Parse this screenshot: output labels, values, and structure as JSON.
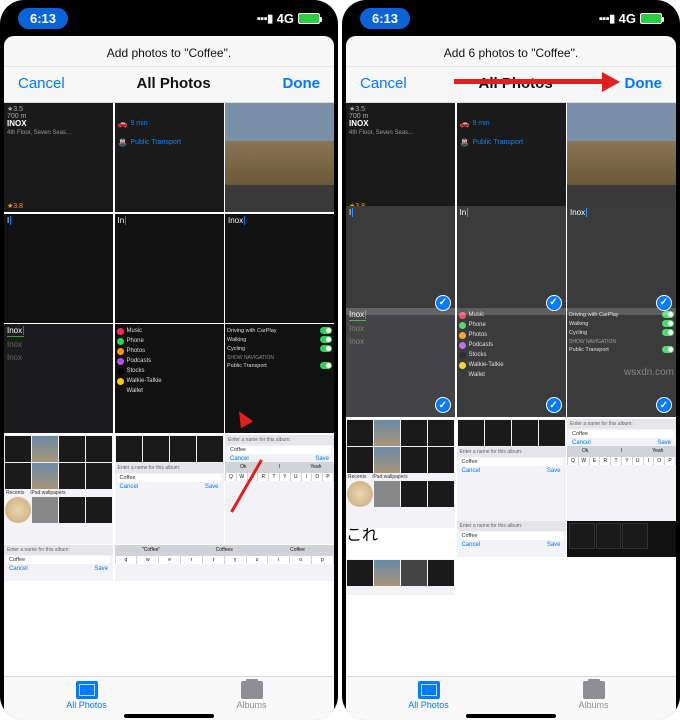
{
  "status": {
    "time": "6:13",
    "network": "4G"
  },
  "left": {
    "title": "Add photos to \"Coffee\".",
    "cancel": "Cancel",
    "picker_title": "All Photos",
    "done": "Done"
  },
  "right": {
    "title": "Add 6 photos to \"Coffee\".",
    "cancel": "Cancel",
    "picker_title": "All Photos",
    "done": "Done"
  },
  "maps": {
    "rating": "★3.5",
    "distance": "700 m",
    "venue": "INOX",
    "address": "4th Floor, Seven Seas...",
    "rating2": "★3.8",
    "drive_time": "9 min",
    "transport": "Public Transport"
  },
  "search": {
    "q1": "I",
    "q2": "In",
    "q3": "Inox",
    "q4": "Inox"
  },
  "inox_list": {
    "item1": "Inox",
    "item2": "Inox"
  },
  "settings": {
    "music": "Music",
    "phone": "Phone",
    "photos": "Photos",
    "podcasts": "Podcasts",
    "stocks": "Stocks",
    "walkie": "Walkie-Talkie",
    "wallet": "Wallet"
  },
  "nav": {
    "carplay": "Driving with CarPlay",
    "walking": "Walking",
    "cycling": "Cycling",
    "section": "SHOW NAVIGATION",
    "pub": "Public Transport"
  },
  "album_labels": {
    "recents": "Recents",
    "ipad": "iPad wallpapers"
  },
  "prompt": {
    "label": "Enter a name for this album:",
    "value": "Coffee",
    "cancel": "Cancel",
    "save": "Save"
  },
  "kb_suggest": {
    "s1": "\"Coffee\"",
    "s2": "Coffees",
    "s3": "Coffee"
  },
  "kb_suggest2": {
    "s1": "Ok",
    "s2": "I",
    "s3": "Yeah"
  },
  "keys": [
    "q",
    "w",
    "e",
    "r",
    "t",
    "y",
    "u",
    "i",
    "o",
    "p"
  ],
  "keys_upper": [
    "Q",
    "W",
    "E",
    "R",
    "T",
    "Y",
    "U",
    "I",
    "O",
    "P"
  ],
  "tabs": {
    "all": "All Photos",
    "albums": "Albums"
  },
  "watermark": "wsxdn.com"
}
